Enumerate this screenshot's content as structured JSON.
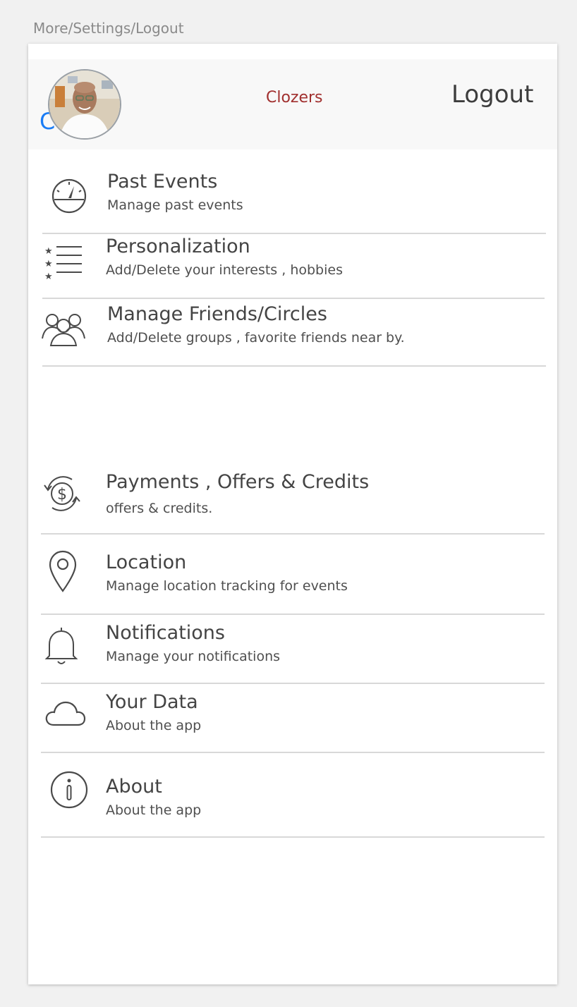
{
  "page_label": "More/Settings/Logout",
  "header": {
    "back_glyph": "C",
    "brand": "Clozers",
    "logout_label": "Logout",
    "avatar_icon": "user-photo"
  },
  "menu": [
    {
      "title": "Past Events",
      "subtitle": "Manage past events",
      "icon": "speedometer-icon"
    },
    {
      "title": "Personalization",
      "subtitle": "Add/Delete your interests , hobbies",
      "icon": "starred-list-icon"
    },
    {
      "title": "Manage Friends/Circles",
      "subtitle": "Add/Delete groups , favorite friends near by.",
      "icon": "group-icon"
    },
    {
      "title": "Payments , Offers & Credits",
      "subtitle": "offers & credits.",
      "icon": "dollar-refresh-icon"
    },
    {
      "title": "Location",
      "subtitle": "Manage location tracking for events",
      "icon": "location-pin-icon"
    },
    {
      "title": "Notifications",
      "subtitle": "Manage your notifications",
      "icon": "bell-icon"
    },
    {
      "title": "Your Data",
      "subtitle": "About the app",
      "icon": "cloud-icon"
    },
    {
      "title": "About",
      "subtitle": "About the app",
      "icon": "info-icon"
    }
  ],
  "colors": {
    "brand": "#a1302f",
    "back_link": "#1a7cf5",
    "text": "#444444",
    "divider": "#d8d8d8"
  }
}
